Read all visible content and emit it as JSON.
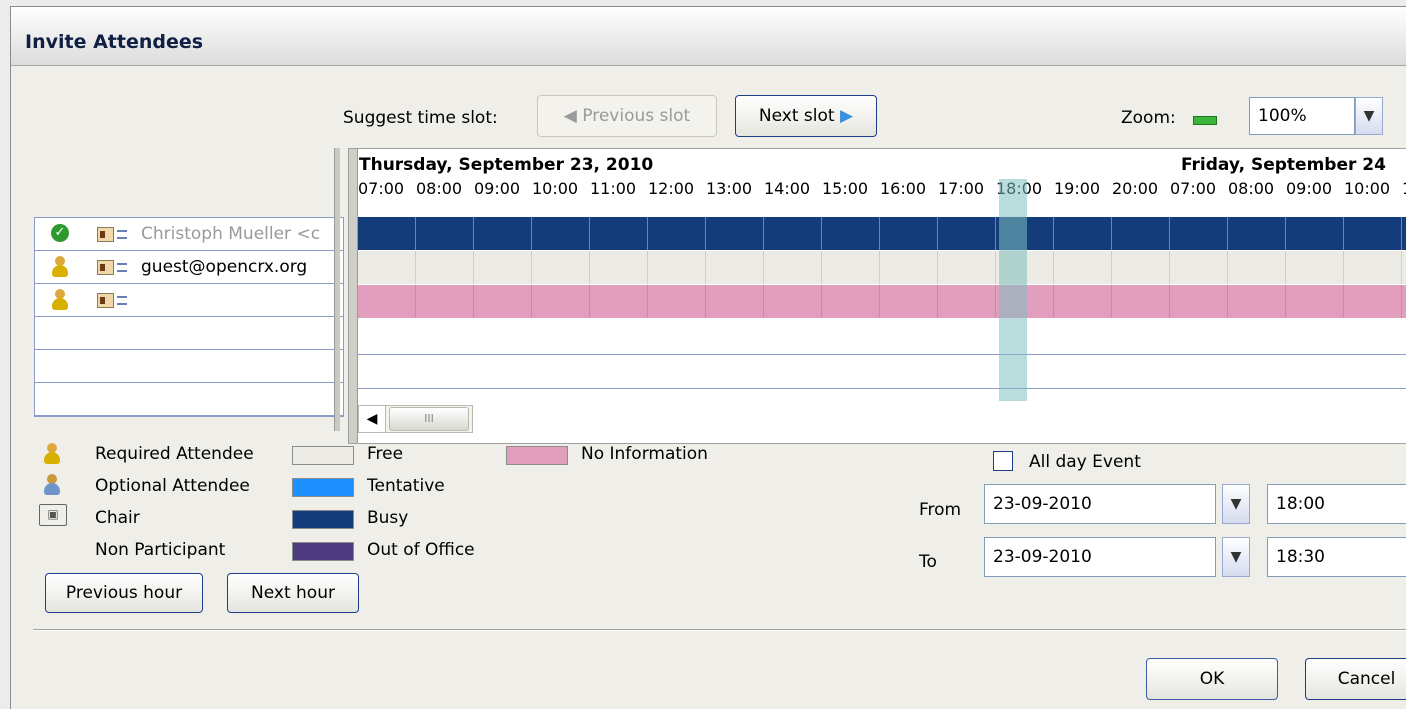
{
  "window": {
    "title": "Invite Attendees"
  },
  "toolbar": {
    "suggest_label": "Suggest time slot:",
    "previous_slot": "Previous slot",
    "next_slot": "Next slot",
    "zoom_label": "Zoom:",
    "zoom_value": "100%"
  },
  "attendees": [
    {
      "status": "accepted",
      "name": "Christoph Mueller <c"
    },
    {
      "status": "required",
      "name": "guest@opencrx.org"
    },
    {
      "status": "required",
      "name": ""
    }
  ],
  "schedule": {
    "day1": "Thursday, September 23, 2010",
    "day2": "Friday, September 24",
    "hours": [
      "07:00",
      "08:00",
      "09:00",
      "10:00",
      "11:00",
      "12:00",
      "13:00",
      "14:00",
      "15:00",
      "16:00",
      "17:00",
      "18:00",
      "19:00",
      "20:00",
      "07:00",
      "08:00",
      "09:00",
      "10:00",
      "1"
    ]
  },
  "legend": {
    "required": "Required Attendee",
    "optional": "Optional Attendee",
    "chair": "Chair",
    "non_participant": "Non Participant",
    "free": "Free",
    "tentative": "Tentative",
    "busy": "Busy",
    "out_of_office": "Out of Office",
    "no_information": "No Information"
  },
  "colors": {
    "free": "#ecebe5",
    "tentative": "#1e90ff",
    "busy": "#153c7a",
    "out_of_office": "#4e3a7e",
    "no_information": "#e29ebd",
    "selection": "#7fbfbf"
  },
  "buttons": {
    "previous_hour": "Previous hour",
    "next_hour": "Next hour",
    "ok": "OK",
    "cancel": "Cancel"
  },
  "event": {
    "all_day_label": "All day Event",
    "all_day_checked": false,
    "from_label": "From",
    "to_label": "To",
    "from_date": "23-09-2010",
    "from_time": "18:00",
    "to_date": "23-09-2010",
    "to_time": "18:30"
  },
  "scrollbar": {
    "thumb_grip": "III"
  }
}
